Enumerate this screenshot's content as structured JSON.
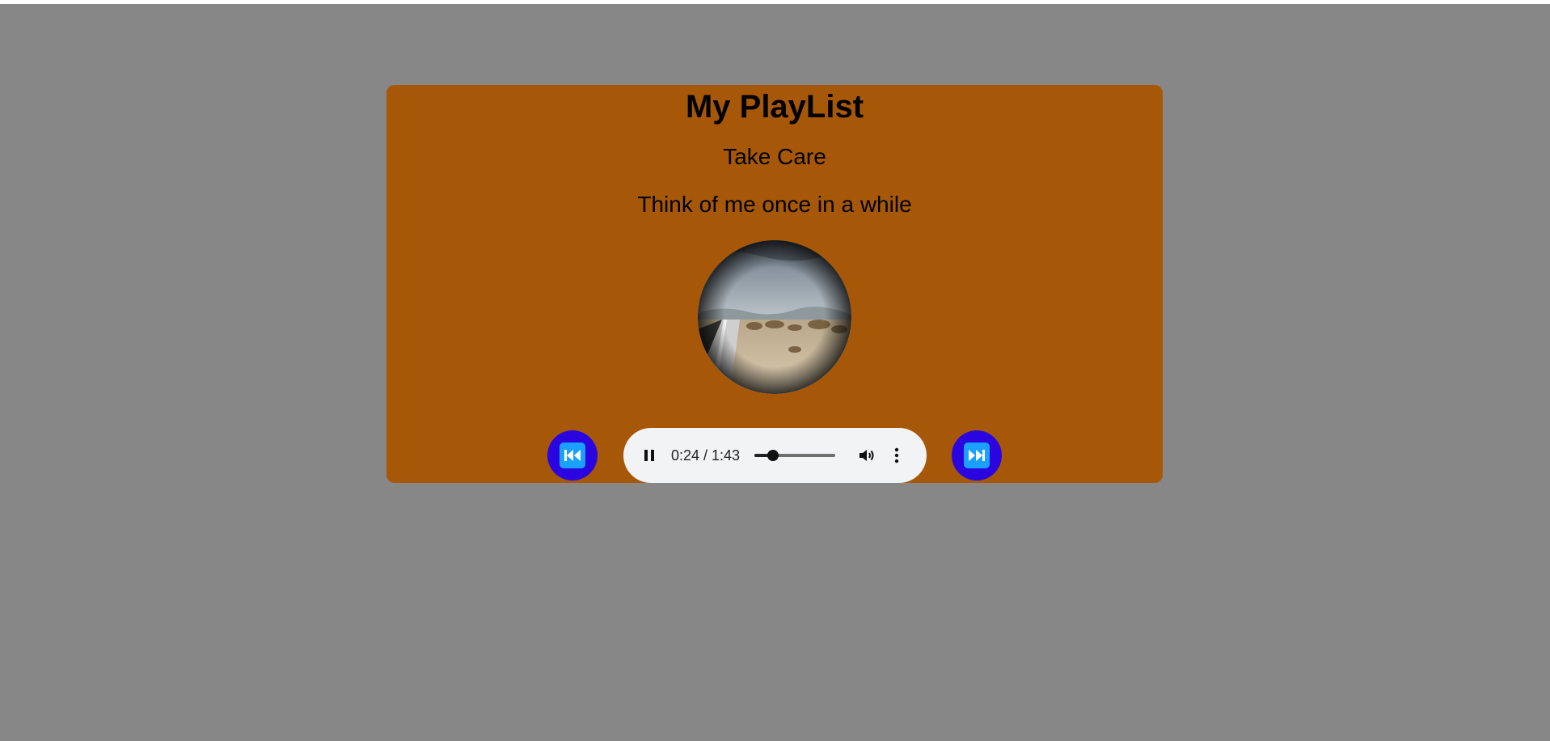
{
  "page": {
    "background_color": "#878787",
    "card_color": "#a65808",
    "button_color": "#2a05e0",
    "button_icon_color": "#1aa0ff"
  },
  "playlist": {
    "title": "My PlayList",
    "song_title": "Take Care",
    "song_lyric": "Think of me once in a while"
  },
  "controls": {
    "prev_icon": "rewind-icon",
    "next_icon": "fast-forward-icon"
  },
  "player": {
    "state": "playing",
    "play_pause_icon": "pause-icon",
    "time_display": "0:24 / 1:43",
    "progress_fraction": 0.233,
    "volume_icon": "volume-icon",
    "menu_icon": "more-vertical-icon"
  }
}
